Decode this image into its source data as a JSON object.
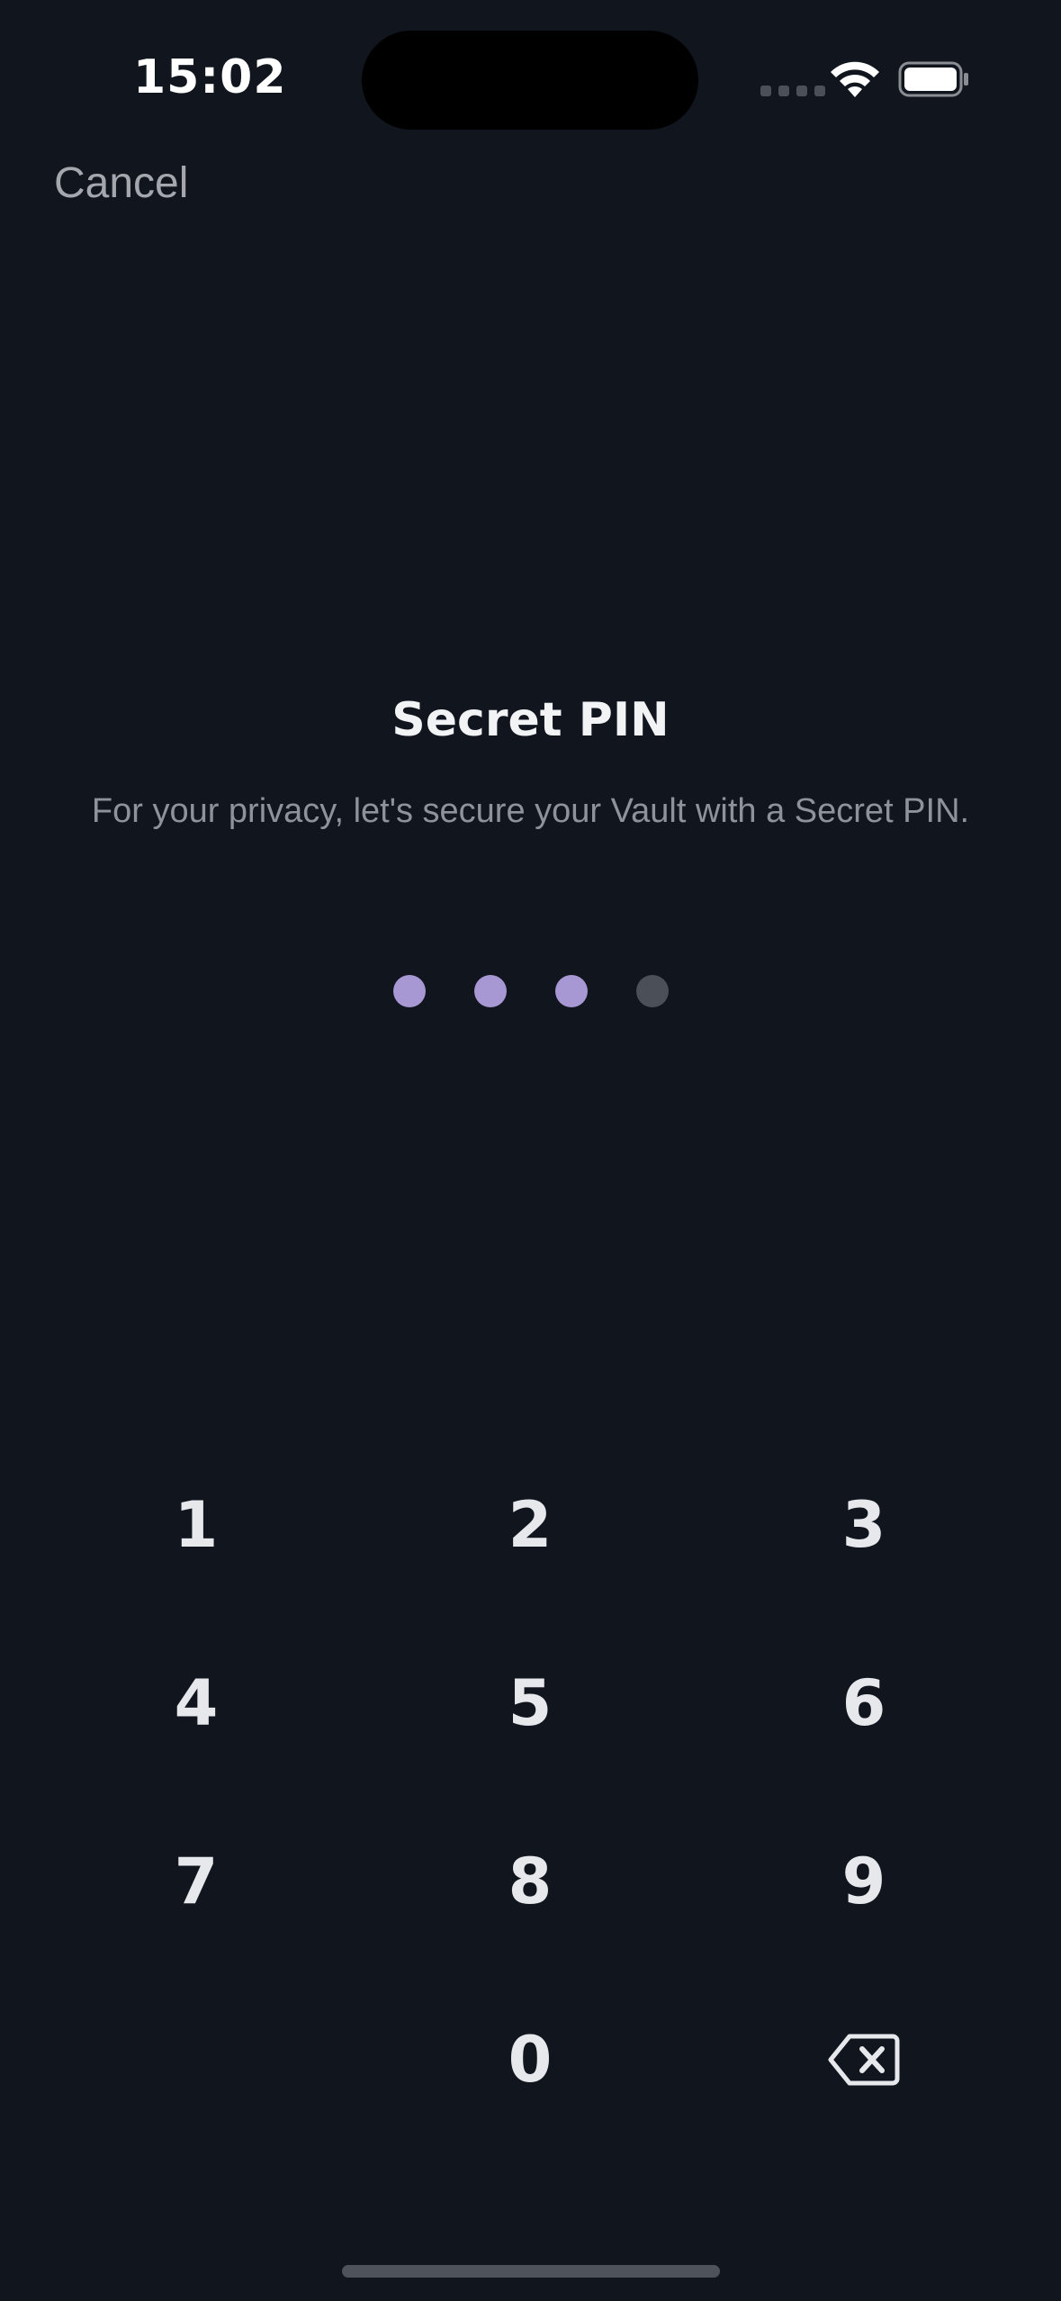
{
  "status_bar": {
    "time": "15:02",
    "signal_icon": "signal-bars-icon",
    "wifi_icon": "wifi-icon",
    "battery_icon": "battery-icon"
  },
  "header": {
    "cancel_label": "Cancel"
  },
  "pin": {
    "title": "Secret PIN",
    "subtitle": "For your privacy, let's secure your Vault with a Secret PIN.",
    "length": 4,
    "entered": 3,
    "filled_color": "#a797d2",
    "empty_color": "#4b4f57"
  },
  "keypad": {
    "keys": [
      "1",
      "2",
      "3",
      "4",
      "5",
      "6",
      "7",
      "8",
      "9",
      "0"
    ],
    "delete_icon": "backspace-icon"
  }
}
